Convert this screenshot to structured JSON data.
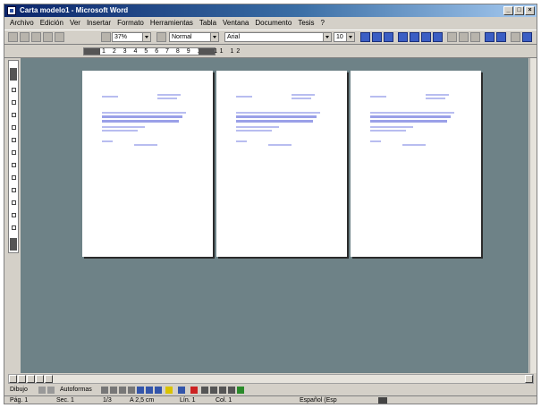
{
  "window": {
    "title": "Carta modelo1 - Microsoft Word",
    "buttons": [
      "_",
      "□",
      "×"
    ]
  },
  "menu": {
    "items": [
      "Archivo",
      "Edición",
      "Ver",
      "Insertar",
      "Formato",
      "Herramientas",
      "Tabla",
      "Ventana",
      "Documento",
      "Tesis",
      "?"
    ]
  },
  "toolbar": {
    "zoom": "37%",
    "style": "Normal",
    "font": "Arial",
    "size": "10"
  },
  "ruler": {
    "numbers": "1 2 3 4 5 6 7 8 9 10 11 12"
  },
  "pages": [
    {
      "index": 1
    },
    {
      "index": 2
    },
    {
      "index": 3
    }
  ],
  "drawing": {
    "draw_label": "Dibujo",
    "autoshapes_label": "Autoformas"
  },
  "status": {
    "page": "Pág. 1",
    "section": "Sec. 1",
    "pos": "1/3",
    "at": "A 2,5 cm",
    "line": "Lín. 1",
    "col": "Col. 1",
    "lang": "Español (Esp"
  }
}
